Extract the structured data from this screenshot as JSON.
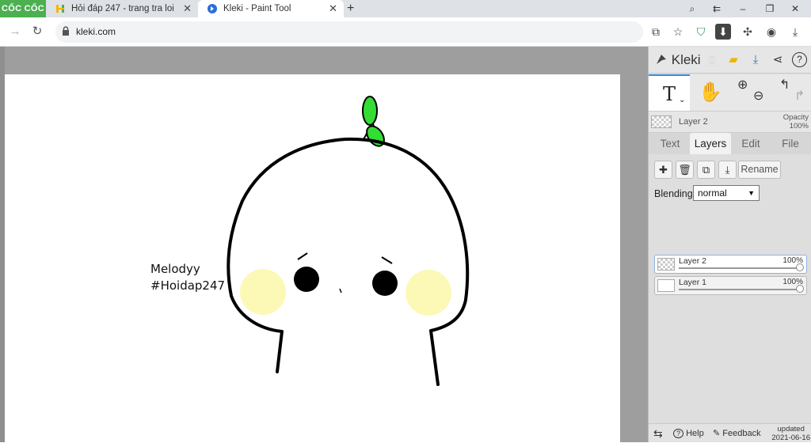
{
  "browser": {
    "brand": "CỐC CỐC",
    "tabs": [
      {
        "title": "Hỏi đáp 247 - trang tra loi",
        "icon": "hoidap-favicon"
      },
      {
        "title": "Kleki - Paint Tool",
        "icon": "kleki-favicon",
        "active": true
      }
    ],
    "url": "kleki.com",
    "new_tab": "+",
    "close": "✕"
  },
  "canvas": {
    "signature_line1": "Melodyy",
    "signature_line2": "#Hoidap247",
    "colors": {
      "outline": "#000000",
      "blush": "#fcf9b7",
      "sprout": "#33dd33",
      "paper": "#ffffff",
      "workspace": "#9e9e9e"
    }
  },
  "kleki": {
    "logo": "Kleki",
    "current_layer": {
      "name": "Layer 2",
      "opacity_label": "Opacity",
      "opacity": "100%"
    },
    "tabs": [
      "Text",
      "Layers",
      "Edit",
      "File"
    ],
    "active_tab": "Layers",
    "rename_label": "Rename",
    "blending_label": "Blending",
    "blending_value": "normal",
    "layers": [
      {
        "name": "Layer 2",
        "opacity": "100%",
        "selected": true
      },
      {
        "name": "Layer 1",
        "opacity": "100%",
        "selected": false
      }
    ],
    "footer": {
      "help": "Help",
      "feedback": "Feedback",
      "updated_label": "updated",
      "updated_date": "2021-06-16"
    }
  }
}
